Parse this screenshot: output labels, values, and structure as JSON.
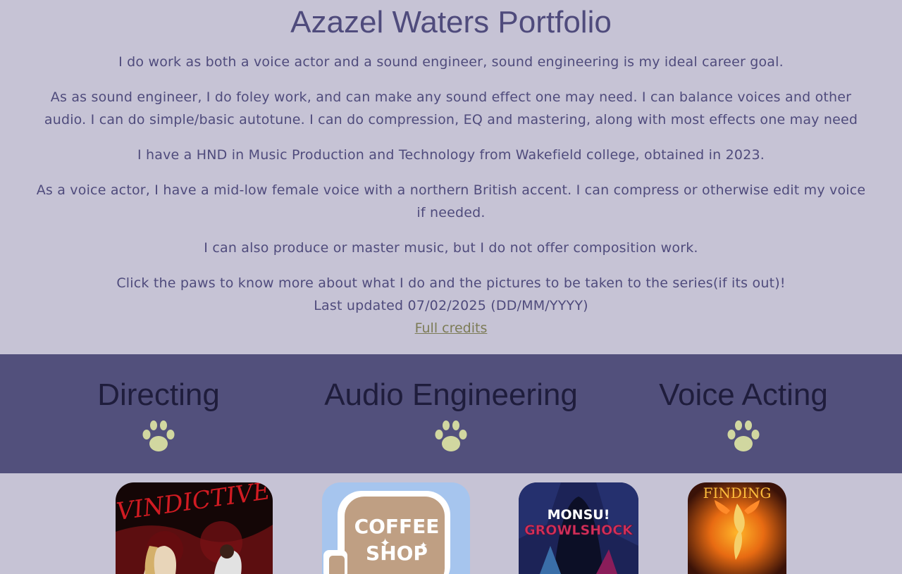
{
  "header": {
    "title": "Azazel Waters Portfolio",
    "paragraphs": [
      "I do work as both a voice actor and a sound engineer, sound engineering is my ideal career goal.",
      "As as sound engineer, I do foley work, and can make any sound effect one may need. I can balance voices and other audio. I can do simple/basic autotune. I can do compression, EQ and mastering, along with most effects one may need",
      "I have a HND in Music Production and Technology from Wakefield college, obtained in 2023.",
      "As a voice actor, I have a mid-low female voice with a northern British accent. I can compress or otherwise edit my voice if needed.",
      "I can also produce or master music, but I do not offer composition work.",
      "Click the paws to know more about what I do and the pictures to be taken to the series(if its out)!"
    ],
    "last_updated": "Last updated 07/02/2025 (DD/MM/YYYY)",
    "credits_link": "Full credits"
  },
  "sections": [
    {
      "title": "Directing",
      "icon": "paw-icon"
    },
    {
      "title": "Audio Engineering",
      "icon": "paw-icon"
    },
    {
      "title": "Voice Acting",
      "icon": "paw-icon"
    }
  ],
  "covers": [
    {
      "title_text": "VINDICTIVE"
    },
    {
      "title_text": "COFFEE SHOP"
    },
    {
      "title_text": "MONSU! GROWLSHOCK"
    },
    {
      "title_text": "FINDING"
    }
  ],
  "colors": {
    "background": "#c6c3d5",
    "text": "#4f4b7c",
    "band": "#52507c",
    "band_heading": "#1f1d3c",
    "paw": "#d1d7a0",
    "link": "#7c7b56"
  }
}
